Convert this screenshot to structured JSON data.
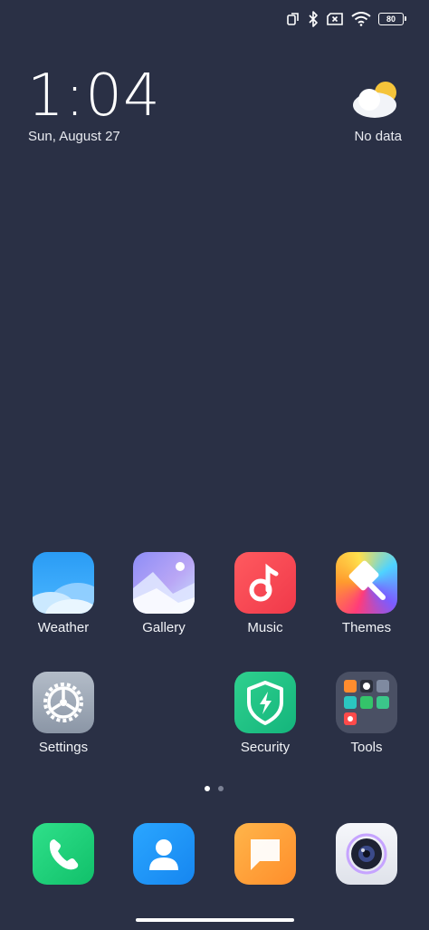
{
  "status_bar": {
    "icons": [
      "rotate-lock-icon",
      "bluetooth-icon",
      "sim-x-icon",
      "wifi-icon"
    ],
    "battery_level": "80"
  },
  "clock": {
    "time": "1:04",
    "date": "Sun, August 27"
  },
  "weather_widget": {
    "icon": "partly-cloudy-icon",
    "text": "No data"
  },
  "apps": [
    {
      "label": "Weather",
      "icon": "weather-icon"
    },
    {
      "label": "Gallery",
      "icon": "gallery-icon"
    },
    {
      "label": "Music",
      "icon": "music-icon"
    },
    {
      "label": "Themes",
      "icon": "themes-icon"
    },
    {
      "label": "Settings",
      "icon": "settings-icon"
    },
    {
      "label": "Security",
      "icon": "security-icon"
    },
    {
      "label": "Tools",
      "icon": "tools-folder-icon"
    }
  ],
  "page_indicator": {
    "pages": 2,
    "active": 1
  },
  "dock": [
    {
      "name": "phone",
      "icon": "phone-icon"
    },
    {
      "name": "contacts",
      "icon": "contacts-icon"
    },
    {
      "name": "messages",
      "icon": "messages-icon"
    },
    {
      "name": "camera",
      "icon": "camera-icon"
    }
  ]
}
